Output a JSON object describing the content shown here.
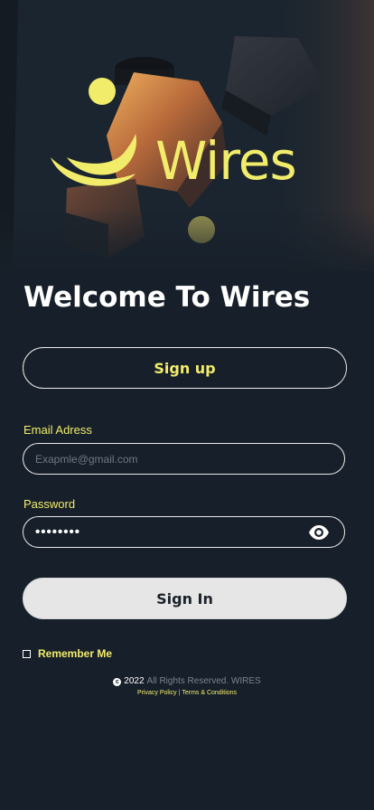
{
  "brand": {
    "name": "Wires",
    "accent_color": "#f2ec6b"
  },
  "welcome": {
    "title": "Welcome To Wires"
  },
  "signup": {
    "label": "Sign up"
  },
  "form": {
    "email": {
      "label": "Email Adress",
      "placeholder": "Exapmle@gmail.com",
      "value": ""
    },
    "password": {
      "label": "Password",
      "value": "••••••••",
      "toggle_icon": "eye-icon"
    }
  },
  "signin": {
    "label": "Sign In"
  },
  "remember": {
    "label": "Remember Me",
    "checked": false
  },
  "footer": {
    "copyright_symbol": "c",
    "year": "2022",
    "rights": "All Rights Reserved. WIRES",
    "privacy": "Privacy Policy",
    "separator": "|",
    "terms": "Terms & Conditions"
  }
}
